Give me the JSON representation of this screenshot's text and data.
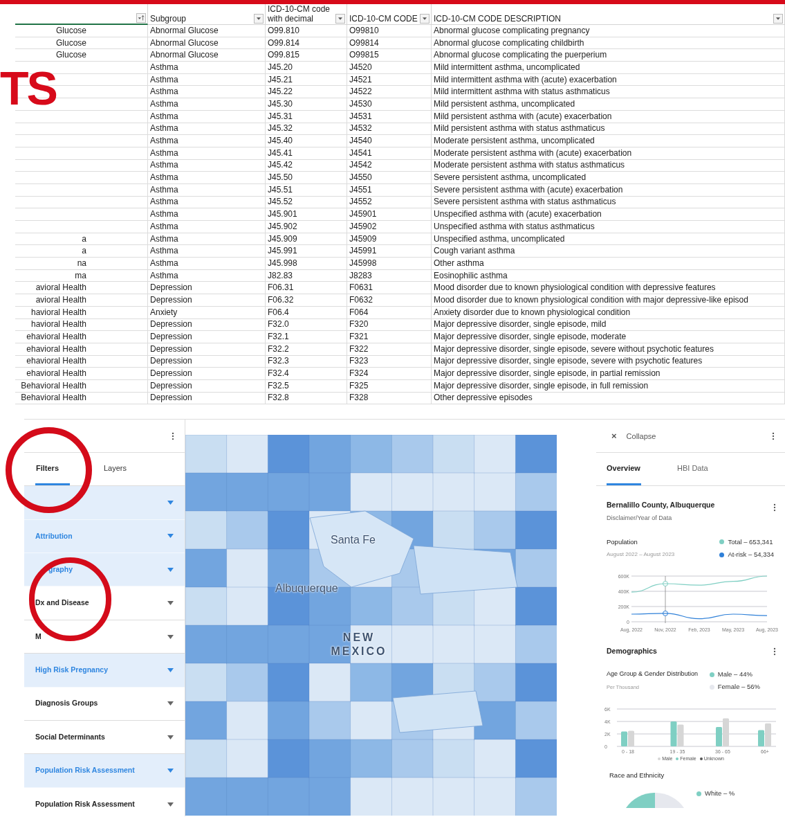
{
  "slide": {
    "title_fragment": "TS"
  },
  "spreadsheet": {
    "columns": [
      {
        "kind": "sorted",
        "selected": true
      },
      {
        "label": "Subgroup",
        "kind": "filter",
        "selected": false
      },
      {
        "label_above": "ICD-10-CM code",
        "label": "with decimal",
        "kind": "filter",
        "selected": false
      },
      {
        "label": "ICD-10-CM CODE",
        "kind": "filter",
        "selected": false
      },
      {
        "label": "ICD-10-CM CODE DESCRIPTION",
        "kind": "filter",
        "selected": false
      }
    ],
    "rows": [
      {
        "column_1": "Glucose",
        "subgroup": "Abnormal Glucose",
        "code_decimal": "O99.810",
        "code": "O99810",
        "description": "Abnormal glucose complicating pregnancy"
      },
      {
        "column_1": "Glucose",
        "subgroup": "Abnormal Glucose",
        "code_decimal": "O99.814",
        "code": "O99814",
        "description": "Abnormal glucose complicating childbirth"
      },
      {
        "column_1": "Glucose",
        "subgroup": "Abnormal Glucose",
        "code_decimal": "O99.815",
        "code": "O99815",
        "description": "Abnormal glucose complicating the puerperium"
      },
      {
        "subgroup": "Asthma",
        "code_decimal": "J45.20",
        "code": "J4520",
        "description": "Mild intermittent asthma, uncomplicated"
      },
      {
        "subgroup": "Asthma",
        "code_decimal": "J45.21",
        "code": "J4521",
        "description": "Mild intermittent asthma with (acute) exacerbation"
      },
      {
        "subgroup": "Asthma",
        "code_decimal": "J45.22",
        "code": "J4522",
        "description": "Mild intermittent asthma with status asthmaticus"
      },
      {
        "subgroup": "Asthma",
        "code_decimal": "J45.30",
        "code": "J4530",
        "description": "Mild persistent asthma, uncomplicated"
      },
      {
        "subgroup": "Asthma",
        "code_decimal": "J45.31",
        "code": "J4531",
        "description": "Mild persistent asthma with (acute) exacerbation"
      },
      {
        "subgroup": "Asthma",
        "code_decimal": "J45.32",
        "code": "J4532",
        "description": "Mild persistent asthma with status asthmaticus"
      },
      {
        "subgroup": "Asthma",
        "code_decimal": "J45.40",
        "code": "J4540",
        "description": "Moderate persistent asthma, uncomplicated"
      },
      {
        "subgroup": "Asthma",
        "code_decimal": "J45.41",
        "code": "J4541",
        "description": "Moderate persistent asthma with (acute) exacerbation"
      },
      {
        "subgroup": "Asthma",
        "code_decimal": "J45.42",
        "code": "J4542",
        "description": "Moderate persistent asthma with status asthmaticus"
      },
      {
        "subgroup": "Asthma",
        "code_decimal": "J45.50",
        "code": "J4550",
        "description": "Severe persistent asthma, uncomplicated"
      },
      {
        "subgroup": "Asthma",
        "code_decimal": "J45.51",
        "code": "J4551",
        "description": "Severe persistent asthma with (acute) exacerbation"
      },
      {
        "subgroup": "Asthma",
        "code_decimal": "J45.52",
        "code": "J4552",
        "description": "Severe persistent asthma with status asthmaticus"
      },
      {
        "subgroup": "Asthma",
        "code_decimal": "J45.901",
        "code": "J45901",
        "description": "Unspecified asthma with (acute) exacerbation"
      },
      {
        "subgroup": "Asthma",
        "code_decimal": "J45.902",
        "code": "J45902",
        "description": "Unspecified asthma with status asthmaticus"
      },
      {
        "column_1": "a",
        "subgroup": "Asthma",
        "code_decimal": "J45.909",
        "code": "J45909",
        "description": "Unspecified asthma, uncomplicated"
      },
      {
        "column_1": "a",
        "subgroup": "Asthma",
        "code_decimal": "J45.991",
        "code": "J45991",
        "description": "Cough variant asthma"
      },
      {
        "column_1": "na",
        "subgroup": "Asthma",
        "code_decimal": "J45.998",
        "code": "J45998",
        "description": "Other asthma"
      },
      {
        "column_1": "ma",
        "subgroup": "Asthma",
        "code_decimal": "J82.83",
        "code": "J8283",
        "description": "Eosinophilic asthma"
      },
      {
        "column_1": "avioral Health",
        "subgroup": "Depression",
        "code_decimal": "F06.31",
        "code": "F0631",
        "description": "Mood disorder due to known physiological condition with depressive features"
      },
      {
        "column_1": "avioral Health",
        "subgroup": "Depression",
        "code_decimal": "F06.32",
        "code": "F0632",
        "description": "Mood disorder due to known physiological condition with major depressive-like episod"
      },
      {
        "column_1": "havioral Health",
        "subgroup": "Anxiety",
        "code_decimal": "F06.4",
        "code": "F064",
        "description": "Anxiety disorder due to known physiological condition"
      },
      {
        "column_1": "havioral Health",
        "subgroup": "Depression",
        "code_decimal": "F32.0",
        "code": "F320",
        "description": "Major depressive disorder, single episode, mild"
      },
      {
        "column_1": "ehavioral Health",
        "subgroup": "Depression",
        "code_decimal": "F32.1",
        "code": "F321",
        "description": "Major depressive disorder, single episode, moderate"
      },
      {
        "column_1": "ehavioral Health",
        "subgroup": "Depression",
        "code_decimal": "F32.2",
        "code": "F322",
        "description": "Major depressive disorder, single episode, severe without psychotic features"
      },
      {
        "column_1": "ehavioral Health",
        "subgroup": "Depression",
        "code_decimal": "F32.3",
        "code": "F323",
        "description": "Major depressive disorder, single episode, severe with psychotic features"
      },
      {
        "column_1": "ehavioral Health",
        "subgroup": "Depression",
        "code_decimal": "F32.4",
        "code": "F324",
        "description": "Major depressive disorder, single episode, in partial remission"
      },
      {
        "column_1": "Behavioral Health",
        "subgroup": "Depression",
        "code_decimal": "F32.5",
        "code": "F325",
        "description": "Major depressive disorder, single episode, in full remission"
      },
      {
        "column_1": "Behavioral Health",
        "subgroup": "Depression",
        "code_decimal": "F32.8",
        "code": "F328",
        "description": "Other depressive episodes"
      }
    ]
  },
  "left_panel": {
    "tabs": [
      {
        "label": "Filters",
        "selected": true
      },
      {
        "label": "Layers",
        "selected": false
      }
    ],
    "filters": [
      {
        "active": true
      },
      {
        "label": "Attribution",
        "active": true,
        "covered": false
      },
      {
        "label": "graphy",
        "active": true,
        "covered": true
      },
      {
        "label": "Dx and Disease",
        "active": false,
        "covered": false
      },
      {
        "label": "M",
        "active": false,
        "covered": false
      },
      {
        "label": "High Risk Pregnancy",
        "active": true,
        "covered": false
      },
      {
        "label": "Diagnosis Groups",
        "active": false,
        "covered": false
      },
      {
        "label": "Social Determinants",
        "active": false,
        "covered": false
      },
      {
        "label": "Population Risk Assessment",
        "active": true,
        "covered": false
      },
      {
        "label": "Population Risk Assessment",
        "active": false,
        "covered": false
      }
    ]
  },
  "map": {
    "labels": [
      {
        "text": "Santa Fe",
        "kind": "city"
      },
      {
        "text": "Albuquerque",
        "kind": "city"
      },
      {
        "text": "NEW MEXICO",
        "kind": "state"
      }
    ]
  },
  "right_panel": {
    "close": "×",
    "title": "Collapse",
    "tabs": [
      {
        "label": "Overview",
        "selected": true
      },
      {
        "label": "HBI Data",
        "selected": false
      }
    ],
    "location": {
      "title": "Bernalillo County, Albuquerque",
      "subtitle": "Disclaimer/Year of Data"
    },
    "population": {
      "title": "Population",
      "period": "August 2022 – August 2023",
      "legend": [
        {
          "label": "Total – 653,341",
          "color": "#7fcfc3"
        },
        {
          "label": "At-risk – 54,334",
          "color": "#2f80d8"
        }
      ],
      "chart_data": {
        "type": "line",
        "categories": [
          "Aug, 2022",
          "Nov, 2022",
          "Feb, 2023",
          "May, 2023",
          "Aug, 2023"
        ],
        "series": [
          {
            "color": "#7fcfc3",
            "values": [
              390000,
              500000,
              480000,
              530000,
              600000
            ]
          },
          {
            "color": "#2f80d8",
            "values": [
              100000,
              110000,
              40000,
              100000,
              80000
            ]
          }
        ],
        "ylim": [
          0,
          600000
        ],
        "ref_lines": [
          {
            "axis": "x",
            "value": "Nov, 2022"
          }
        ],
        "yticks": [
          {
            "value": 0,
            "label": "0"
          },
          {
            "value": 200000,
            "label": "200K"
          },
          {
            "value": 400000,
            "label": "400K"
          },
          {
            "value": 600000,
            "label": "600K"
          }
        ]
      }
    },
    "demographics": {
      "title": "Demographics",
      "subtitle": "Age Group & Gender Distribution",
      "unit": "Per Thousand",
      "legend": [
        {
          "label": "Male – 44%",
          "color": "#7fcfc3"
        },
        {
          "label": "Female – 56%",
          "color": "#e6e8ee"
        }
      ],
      "chart_data": {
        "type": "bar",
        "categories": [
          "0 - 18",
          "19 - 35",
          "36 - 65",
          "66+"
        ],
        "series": [
          {
            "name": "Male",
            "color": "#d6d6d6",
            "values": [
              2500,
              3500,
              4500,
              3700
            ]
          },
          {
            "name": "Female",
            "color": "#7fcfc3",
            "values": [
              2400,
              4000,
              3100,
              2600
            ]
          },
          {
            "name": "Unknown",
            "color": "#555555",
            "values": [
              null,
              null,
              null,
              null
            ]
          }
        ],
        "ylim": [
          0,
          6000
        ],
        "yticks": [
          {
            "value": 0,
            "label": "0"
          },
          {
            "value": 2000,
            "label": "2K"
          },
          {
            "value": 4000,
            "label": "4K"
          },
          {
            "value": 6000,
            "label": "6K"
          }
        ]
      }
    },
    "race": {
      "title": "Race and Ethnicity",
      "legend": [
        {
          "label": "White – %",
          "color": "#7fcfc3"
        }
      ]
    }
  }
}
